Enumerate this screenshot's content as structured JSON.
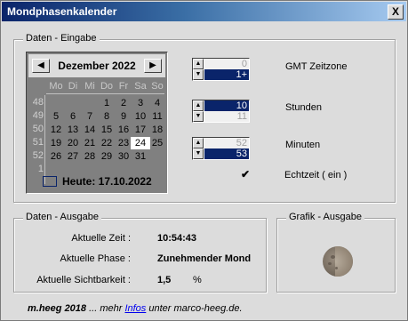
{
  "window": {
    "title": "Mondphasenkalender",
    "close_glyph": "X"
  },
  "input_group": {
    "title": "Daten - Eingabe",
    "calendar": {
      "prev_glyph": "◀",
      "next_glyph": "▶",
      "month_label": "Dezember 2022",
      "weekdays": [
        "Mo",
        "Di",
        "Mi",
        "Do",
        "Fr",
        "Sa",
        "So"
      ],
      "weeks": [
        "48",
        "49",
        "50",
        "51",
        "52",
        "1"
      ],
      "days": [
        [
          "",
          "",
          "",
          "1",
          "2",
          "3",
          "4"
        ],
        [
          "5",
          "6",
          "7",
          "8",
          "9",
          "10",
          "11"
        ],
        [
          "12",
          "13",
          "14",
          "15",
          "16",
          "17",
          "18"
        ],
        [
          "19",
          "20",
          "21",
          "22",
          "23",
          "24",
          "25"
        ],
        [
          "26",
          "27",
          "28",
          "29",
          "30",
          "31",
          ""
        ],
        [
          "",
          "",
          "",
          "",
          "",
          "",
          ""
        ]
      ],
      "selected_day": "24",
      "today_label": "Heute: 17.10.2022"
    },
    "gmt": {
      "label": "GMT Zeitzone",
      "up_value": "0",
      "value": "1+"
    },
    "hours": {
      "label": "Stunden",
      "value": "10",
      "next_value": "11"
    },
    "minutes": {
      "label": "Minuten",
      "prev_value": "52",
      "value": "53"
    },
    "realtime": {
      "label": "Echtzeit ( ein )",
      "checked_glyph": "✔"
    }
  },
  "output_group": {
    "title": "Daten - Ausgabe",
    "time_label": "Aktuelle Zeit :",
    "time_value": "10:54:43",
    "phase_label": "Aktuelle Phase :",
    "phase_value": "Zunehmender Mond",
    "visibility_label": "Aktuelle Sichtbarkeit :",
    "visibility_value": "1,5",
    "visibility_unit": "%"
  },
  "graphic_group": {
    "title": "Grafik - Ausgabe"
  },
  "footer": {
    "author": "m.heeg 2018",
    "text_before": " ... mehr ",
    "link": "Infos",
    "text_after": " unter marco-heeg.de."
  }
}
